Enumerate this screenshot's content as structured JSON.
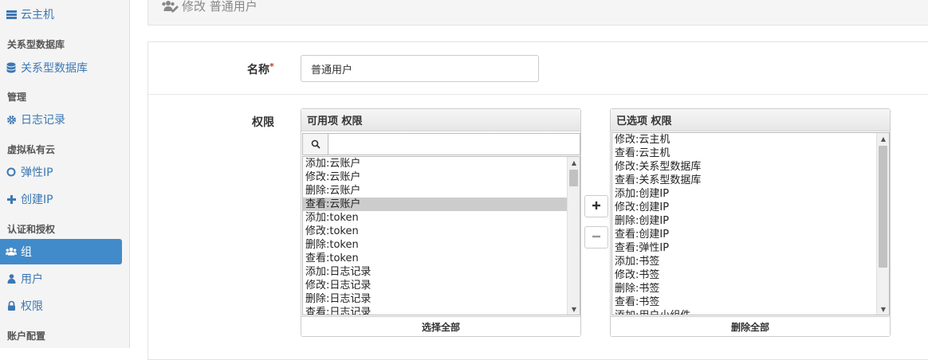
{
  "sidebar": {
    "top_item": "云主机",
    "sections": [
      {
        "heading": "关系型数据库",
        "items": [
          {
            "label": "关系型数据库"
          }
        ]
      },
      {
        "heading": "管理",
        "items": [
          {
            "label": "日志记录"
          }
        ]
      },
      {
        "heading": "虚拟私有云",
        "items": [
          {
            "label": "弹性IP"
          },
          {
            "label": "创建IP"
          }
        ]
      },
      {
        "heading": "认证和授权",
        "items": [
          {
            "label": "组"
          },
          {
            "label": "用户"
          },
          {
            "label": "权限"
          }
        ]
      },
      {
        "heading": "账户配置",
        "items": []
      }
    ],
    "active_item": "组"
  },
  "header": {
    "title": "修改 普通用户"
  },
  "form": {
    "name_label": "名称",
    "required_mark": "*",
    "name_value": "普通用户",
    "perm_label": "权限"
  },
  "available": {
    "title": "可用项 权限",
    "search_placeholder": "",
    "items": [
      "添加:云账户",
      "修改:云账户",
      "删除:云账户",
      "查看:云账户",
      "添加:token",
      "修改:token",
      "删除:token",
      "查看:token",
      "添加:日志记录",
      "修改:日志记录",
      "删除:日志记录",
      "查看:日志记录"
    ],
    "selected_item": "查看:云账户",
    "select_all_label": "选择全部"
  },
  "chosen": {
    "title": "已选项 权限",
    "items": [
      "修改:云主机",
      "查看:云主机",
      "修改:关系型数据库",
      "查看:关系型数据库",
      "添加:创建IP",
      "修改:创建IP",
      "删除:创建IP",
      "查看:创建IP",
      "查看:弹性IP",
      "添加:书签",
      "修改:书签",
      "删除:书签",
      "查看:书签",
      "添加:用户小组件"
    ],
    "remove_all_label": "删除全部"
  },
  "buttons": {
    "add_icon": "plus-icon",
    "remove_icon": "minus-icon"
  },
  "colors": {
    "accent": "#428bca",
    "link": "#3c78b4"
  }
}
